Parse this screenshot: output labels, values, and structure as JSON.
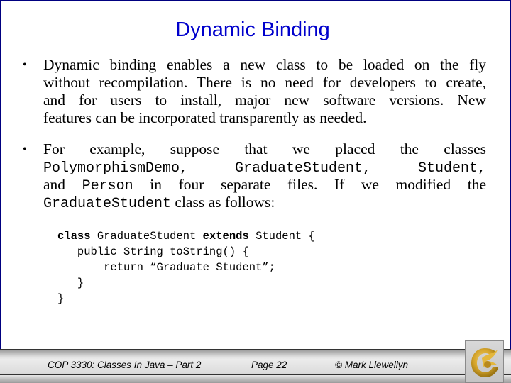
{
  "slide": {
    "title": "Dynamic Binding",
    "bullet_glyph": "•",
    "bullets": [
      {
        "lines": [
          "Dynamic binding enables a new class to be loaded on the fly",
          "without recompilation.  There is no need for developers to create,",
          "and for users to install, major new software versions.  New",
          "features can be incorporated transparently as needed."
        ]
      },
      {
        "lines": [
          {
            "parts": [
              {
                "t": "For example, suppose that we placed the classes",
                "mono": false
              }
            ]
          },
          {
            "parts": [
              {
                "t": "PolymorphismDemo, GraduateStudent, Student,",
                "mono": true
              }
            ]
          },
          {
            "parts": [
              {
                "t": "and ",
                "mono": false
              },
              {
                "t": "Person",
                "mono": true
              },
              {
                "t": " in four separate files.  If we modified the",
                "mono": false
              }
            ]
          },
          {
            "parts": [
              {
                "t": "GraduateStudent",
                "mono": true
              },
              {
                "t": " class as follows:",
                "mono": false
              }
            ]
          }
        ]
      }
    ],
    "code": {
      "kw_class": "class",
      "class_name": " GraduateStudent ",
      "kw_extends": "extends",
      "rest_line1": " Student {",
      "line2": "   public String toString() {",
      "line3": "       return “Graduate Student”;",
      "line4": "   }",
      "line5": "}"
    }
  },
  "footer": {
    "course": "COP 3330:  Classes In Java – Part 2",
    "page": "Page 22",
    "author": "© Mark Llewellyn",
    "logo_icon": "ucf-pegasus-logo"
  },
  "colors": {
    "title": "#0000cc",
    "frame": "#000080",
    "logo_gold": "#c9a227"
  }
}
